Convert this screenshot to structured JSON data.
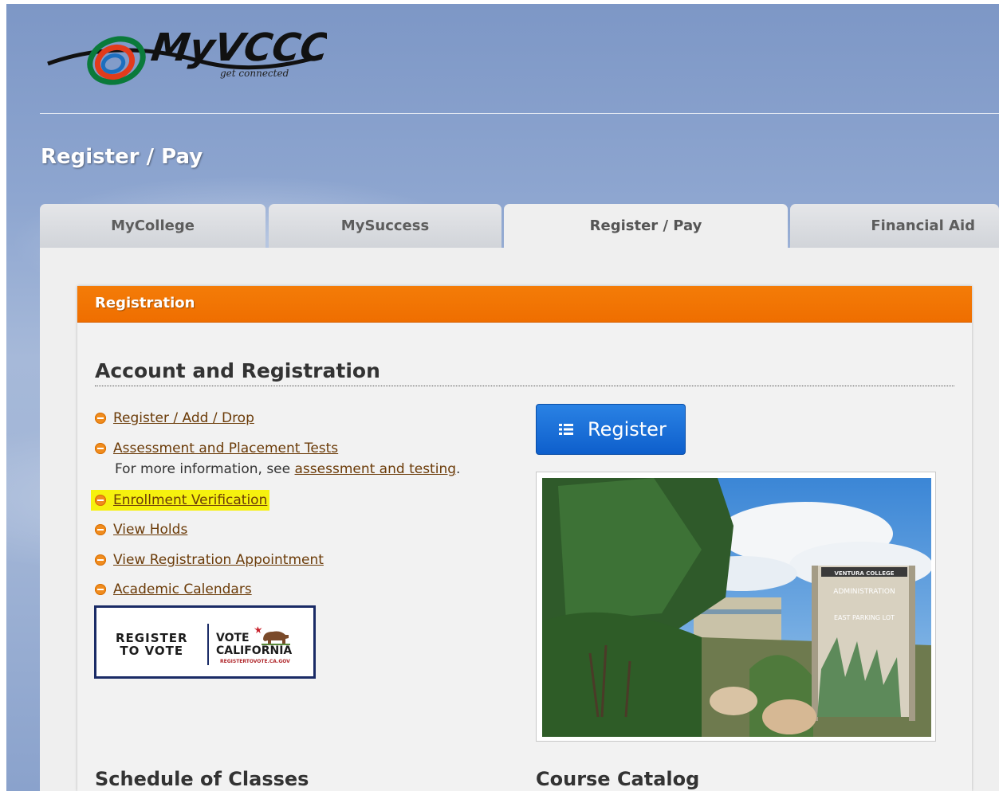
{
  "brand": {
    "logo_text": "MyVCCCD",
    "tagline": "get connected"
  },
  "page": {
    "title": "Register / Pay"
  },
  "tabs": [
    {
      "label": "MyCollege",
      "active": false
    },
    {
      "label": "MySuccess",
      "active": false
    },
    {
      "label": "Register / Pay",
      "active": true
    },
    {
      "label": "Financial Aid",
      "active": false
    }
  ],
  "card": {
    "header": "Registration",
    "section_title": "Account and Registration",
    "links": [
      {
        "label": "Register / Add / Drop"
      },
      {
        "label": "Assessment and Placement Tests"
      },
      {
        "label": "Enrollment Verification",
        "highlighted": true
      },
      {
        "label": "View Holds"
      },
      {
        "label": "View Registration Appointment"
      },
      {
        "label": "Academic Calendars"
      }
    ],
    "info": {
      "prefix": "For more information, see ",
      "link": "assessment and testing",
      "suffix": "."
    },
    "vote_badge": {
      "left_line1": "REGISTER",
      "left_line2": "TO VOTE",
      "right_line1": "VOTE",
      "right_line2": "CALIFORNIA",
      "url": "REGISTERTOVOTE.CA.GOV"
    },
    "register_button": "Register",
    "photo_sign": {
      "line1": "VENTURA COLLEGE",
      "line2": "ADMINISTRATION",
      "line3": "EAST PARKING LOT"
    },
    "bottom_left_title": "Schedule of Classes",
    "bottom_right_title": "Course Catalog"
  },
  "colors": {
    "accent_orange": "#f47c08",
    "button_blue": "#1a6fd8",
    "link_brown": "#6b3b08",
    "highlight_yellow": "#f6f10e"
  }
}
